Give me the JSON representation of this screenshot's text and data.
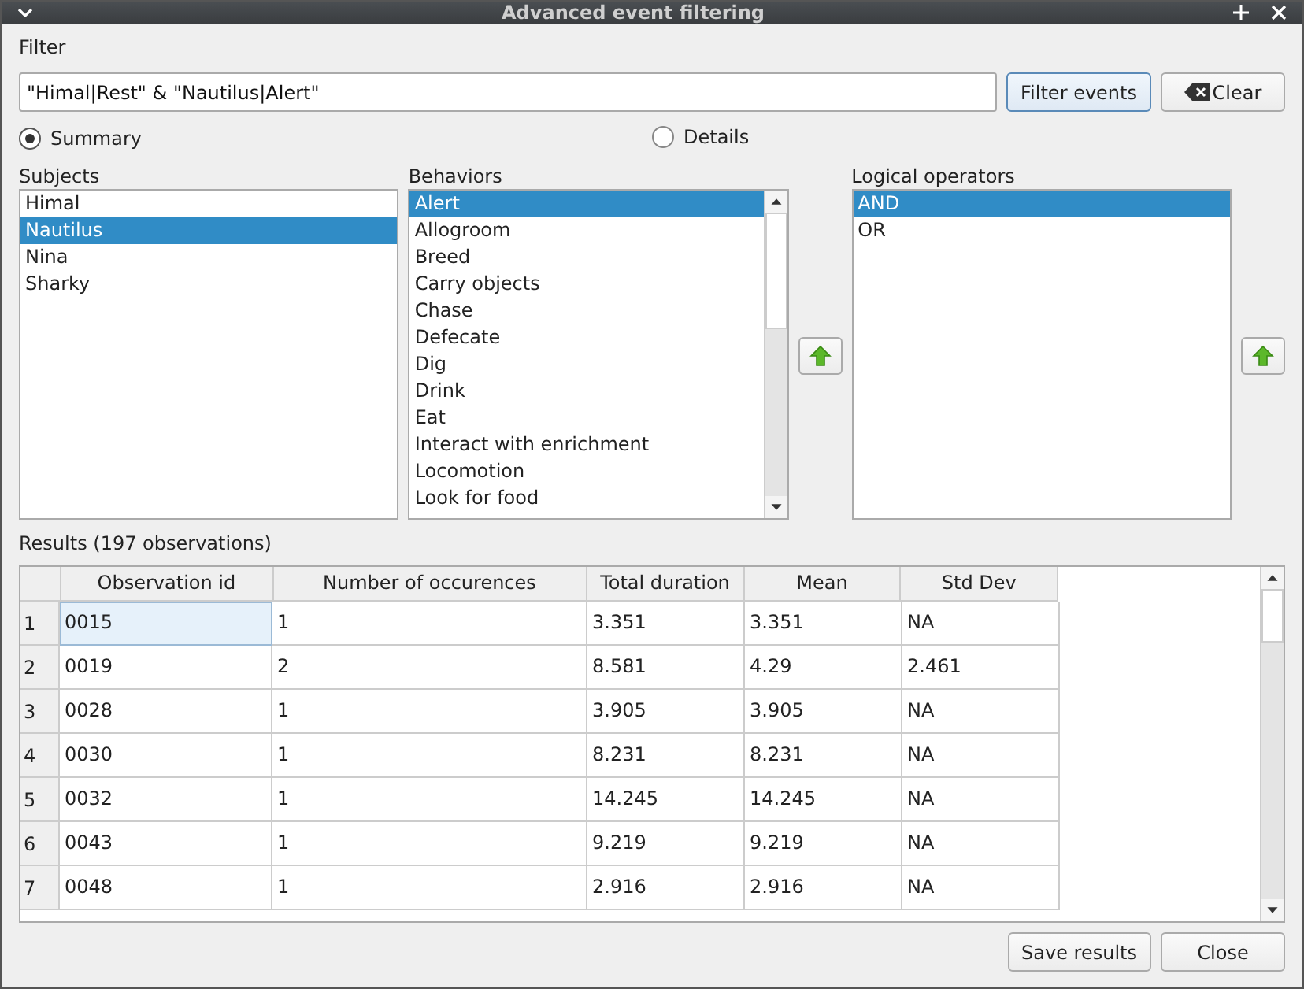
{
  "window": {
    "title": "Advanced event filtering"
  },
  "filter": {
    "label": "Filter",
    "value": "\"Himal|Rest\" & \"Nautilus|Alert\""
  },
  "filter_buttons": [
    {
      "kind": "primary",
      "label": "Filter events"
    },
    {
      "kind": "clear",
      "label": "Clear"
    }
  ],
  "modes": [
    {
      "label": "Summary",
      "selected": true
    },
    {
      "label": "Details",
      "selected": false
    }
  ],
  "subjects": {
    "label": "Subjects",
    "items": [
      {
        "label": "Himal",
        "selected": false
      },
      {
        "label": "Nautilus",
        "selected": true
      },
      {
        "label": "Nina",
        "selected": false
      },
      {
        "label": "Sharky",
        "selected": false
      }
    ]
  },
  "behaviors": {
    "label": "Behaviors",
    "items": [
      {
        "label": "Alert",
        "selected": true
      },
      {
        "label": "Allogroom",
        "selected": false
      },
      {
        "label": "Breed",
        "selected": false
      },
      {
        "label": "Carry objects",
        "selected": false
      },
      {
        "label": "Chase",
        "selected": false
      },
      {
        "label": "Defecate",
        "selected": false
      },
      {
        "label": "Dig",
        "selected": false
      },
      {
        "label": "Drink",
        "selected": false
      },
      {
        "label": "Eat",
        "selected": false
      },
      {
        "label": "Interact with enrichment",
        "selected": false
      },
      {
        "label": "Locomotion",
        "selected": false
      },
      {
        "label": "Look for food",
        "selected": false
      }
    ]
  },
  "logical_operators": {
    "label": "Logical operators",
    "items": [
      {
        "label": "AND",
        "selected": true
      },
      {
        "label": "OR",
        "selected": false
      }
    ]
  },
  "results": {
    "label": "Results (197 observations)",
    "columns": [
      "Observation id",
      "Number of occurences",
      "Total duration",
      "Mean",
      "Std Dev"
    ],
    "rows": [
      {
        "header": "1",
        "focused": true,
        "cells": [
          "0015",
          "1",
          "3.351",
          "3.351",
          "NA"
        ]
      },
      {
        "header": "2",
        "focused": false,
        "cells": [
          "0019",
          "2",
          "8.581",
          "4.29",
          "2.461"
        ]
      },
      {
        "header": "3",
        "focused": false,
        "cells": [
          "0028",
          "1",
          "3.905",
          "3.905",
          "NA"
        ]
      },
      {
        "header": "4",
        "focused": false,
        "cells": [
          "0030",
          "1",
          "8.231",
          "8.231",
          "NA"
        ]
      },
      {
        "header": "5",
        "focused": false,
        "cells": [
          "0032",
          "1",
          "14.245",
          "14.245",
          "NA"
        ]
      },
      {
        "header": "6",
        "focused": false,
        "cells": [
          "0043",
          "1",
          "9.219",
          "9.219",
          "NA"
        ]
      },
      {
        "header": "7",
        "focused": false,
        "cells": [
          "0048",
          "1",
          "2.916",
          "2.916",
          "NA"
        ]
      }
    ]
  },
  "bottom_buttons": [
    "Save results",
    "Close"
  ]
}
